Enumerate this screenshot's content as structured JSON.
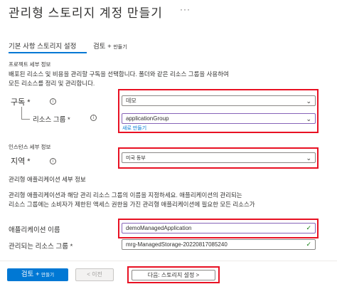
{
  "header": {
    "title": "관리형 스토리지 계정 만들기",
    "more": "···"
  },
  "tabs": [
    {
      "label": "기본 사항 스토리지 설정"
    },
    {
      "label": "검토 +",
      "sub": "만들기"
    }
  ],
  "project": {
    "heading": "프로젝트 세부 정보",
    "desc_line1": "배포된 리소스 및 비용을 관리할 구독을 선택합니다. 폴더와 같은 리소스 그룹을 사용하여",
    "desc_line2": "모든 리소스를 정리 및 관리합니다.",
    "subscription_label": "구독 *",
    "subscription_value": "데모",
    "resource_group_label": "리소스 그룹 *",
    "resource_group_value": "applicationGroup",
    "create_new_link": "새로 만들기"
  },
  "instance": {
    "heading": "인스턴스 세부 정보",
    "region_label": "지역 *",
    "region_value": "미국 동부"
  },
  "managed_app": {
    "heading": "관리형 애플리케이션 세부 정보",
    "desc_line1": "관리형 애플리케이션과 해당 관리 리소스 그룹의 이름을 지정하세요. 애플리케이션의 관리되는",
    "desc_line2": "리소스 그룹에는 소비자가 제한된 액세스 권한을 가진 관리형 애플리케이션에 필요한 모든 리소스가",
    "app_name_label": "애플리케이션 이름",
    "app_name_value": "demoManagedApplication",
    "mrg_label": "관리되는 리소스 그룹 *",
    "mrg_value": "mrg-ManagedStorage-20220817085240"
  },
  "footer": {
    "review_create": "검토 +",
    "review_create_sub": "만들기",
    "previous": "< 이전",
    "next": "다음: 스토리지 설정 >"
  },
  "colors": {
    "accent": "#0078d4",
    "highlight": "#e81123",
    "valid": "#107c10"
  }
}
